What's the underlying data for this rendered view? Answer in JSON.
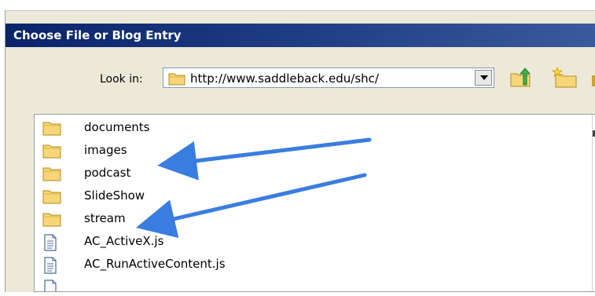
{
  "dialog": {
    "title": "Choose File or Blog Entry",
    "look_in_label": "Look in:",
    "look_in_value": "http://www.saddleback.edu/shc/"
  },
  "files": [
    {
      "name": "documents",
      "icon": "folder-icon"
    },
    {
      "name": "images",
      "icon": "folder-icon"
    },
    {
      "name": "podcast",
      "icon": "folder-icon"
    },
    {
      "name": "SlideShow",
      "icon": "folder-icon"
    },
    {
      "name": "stream",
      "icon": "folder-icon"
    },
    {
      "name": "AC_ActiveX.js",
      "icon": "file-icon"
    },
    {
      "name": "AC_RunActiveContent.js",
      "icon": "file-icon"
    },
    {
      "name": "",
      "icon": "file-icon"
    }
  ],
  "colors": {
    "titlebar": "#0a246a",
    "arrow": "#3a7de0",
    "folder": "#f2c94c",
    "dialog_bg": "#ece9d8"
  }
}
